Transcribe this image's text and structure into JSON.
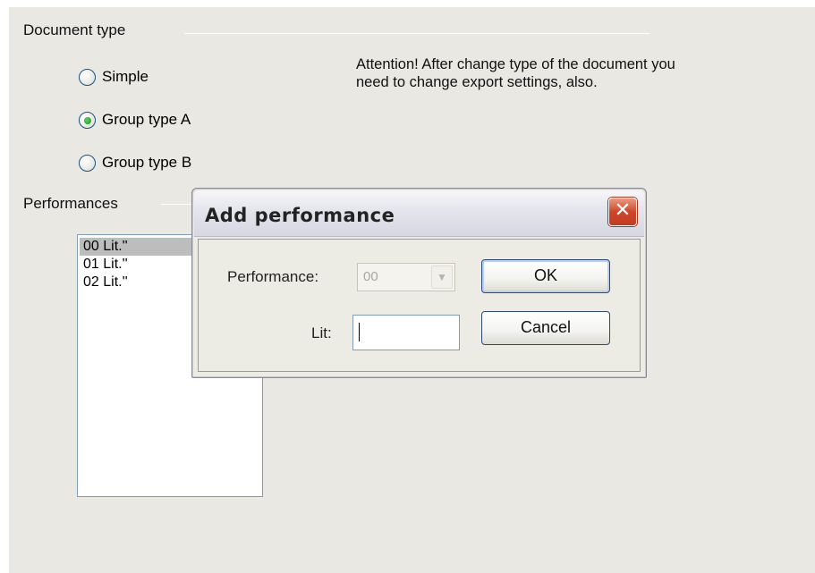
{
  "document_type": {
    "title": "Document type",
    "options": [
      {
        "label": "Simple",
        "checked": false
      },
      {
        "label": "Group type A",
        "checked": true
      },
      {
        "label": "Group type B",
        "checked": false
      }
    ],
    "attention": "Attention! After change type of the document you need to change export settings, also."
  },
  "performances": {
    "title": "Performances",
    "items": [
      "00 Lit.''",
      "01 Lit.''",
      "02 Lit.''"
    ],
    "selected_index": 0
  },
  "dialog": {
    "title": "Add performance",
    "close_glyph": "✕",
    "performance_label": "Performance:",
    "performance_value": "00",
    "lit_label": "Lit:",
    "lit_value": "",
    "ok_label": "OK",
    "cancel_label": "Cancel"
  }
}
